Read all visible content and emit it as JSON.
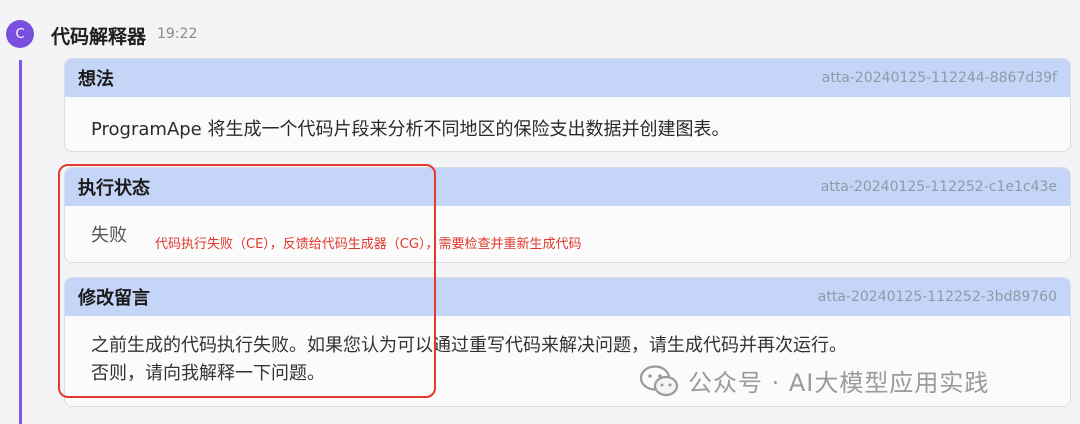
{
  "message": {
    "avatar_letter": "C",
    "sender": "代码解释器",
    "time": "19:22"
  },
  "cards": [
    {
      "title": "想法",
      "id": "atta-20240125-112244-8867d39f",
      "body": "ProgramApe 将生成一个代码片段来分析不同地区的保险支出数据并创建图表。"
    },
    {
      "title": "执行状态",
      "id": "atta-20240125-112252-c1e1c43e",
      "body": "失败"
    },
    {
      "title": "修改留言",
      "id": "atta-20240125-112252-3bd89760",
      "body_line1": "之前生成的代码执行失败。如果您认为可以通过重写代码来解决问题，请生成代码并再次运行。",
      "body_line2": "否则，请向我解释一下问题。"
    }
  ],
  "annotation": {
    "text": "代码执行失败（CE），反馈给代码生成器（CG），需要检查并重新生成代码",
    "color": "#e0392c"
  },
  "watermark": {
    "icon": "wechat-icon",
    "text": "公众号 · AI大模型应用实践"
  },
  "colors": {
    "accent": "#7e57e6",
    "header_bg": "#c5d5f7"
  }
}
